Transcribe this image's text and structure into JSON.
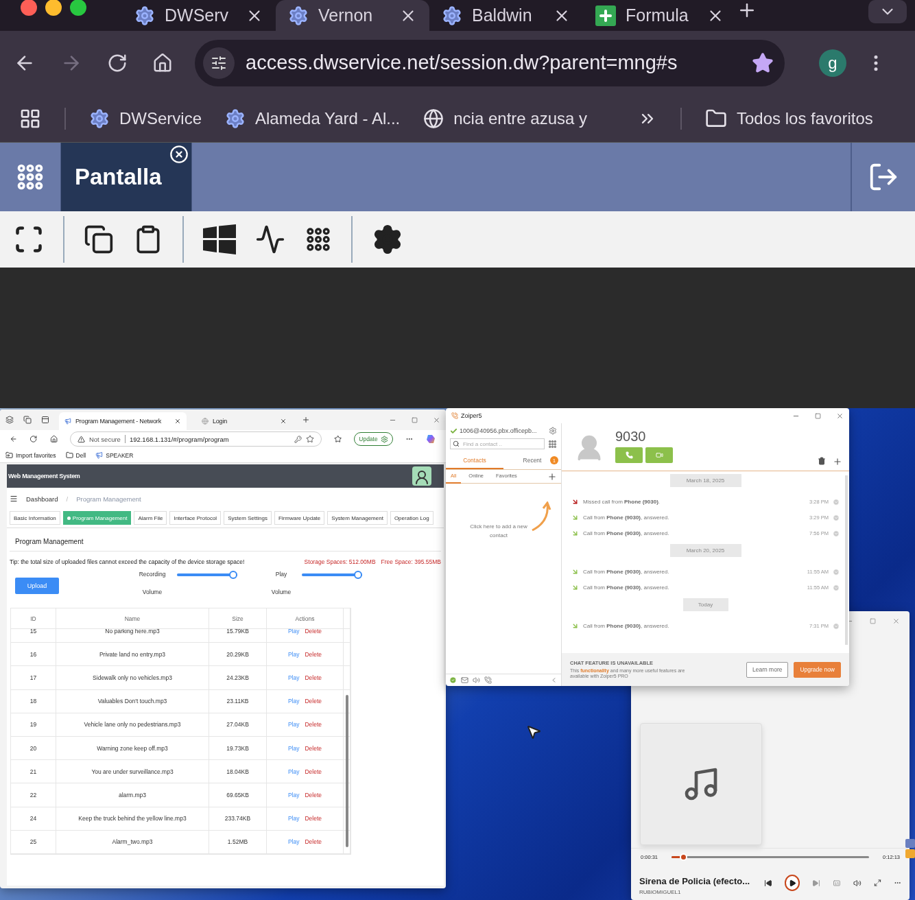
{
  "browser": {
    "tabs": [
      {
        "title": "DWServ",
        "kind": "gear",
        "selected": false
      },
      {
        "title": "Vernon",
        "kind": "gear",
        "selected": true
      },
      {
        "title": "Baldwin",
        "kind": "gear",
        "selected": false
      },
      {
        "title": "Formula",
        "kind": "sheet",
        "selected": false
      }
    ],
    "url": "access.dwservice.net/session.dw?parent=mng#s",
    "profile": "g",
    "bookmarks": [
      {
        "title": "DWService",
        "kind": "gear"
      },
      {
        "title": "Alameda Yard - Al...",
        "kind": "gear"
      },
      {
        "title": "ncia entre azusa y",
        "kind": "globe"
      }
    ],
    "all_bookmarks": "Todos los favoritos"
  },
  "session": {
    "tab": "Pantalla"
  },
  "edge": {
    "tabs": [
      {
        "title": "Program Management - Network",
        "selected": true
      },
      {
        "title": "Login",
        "selected": false
      }
    ],
    "security": "Not secure",
    "url": "192.168.1.131/#/program/program",
    "update": "Update",
    "favorites": [
      {
        "title": "Import favorites",
        "kind": "import"
      },
      {
        "title": "Dell",
        "kind": "folder"
      },
      {
        "title": "SPEAKER",
        "kind": "speaker"
      }
    ],
    "app_title": "Web Management System",
    "breadcrumb": [
      "Dashboard",
      "Program Management"
    ],
    "breadcrumb_separator": "/",
    "nav": [
      {
        "label": "Basic Information",
        "selected": false
      },
      {
        "label": "Program Management",
        "selected": true
      },
      {
        "label": "Alarm File",
        "selected": false
      },
      {
        "label": "Interface Protocol",
        "selected": false
      },
      {
        "label": "System Settings",
        "selected": false
      },
      {
        "label": "Firmware Update",
        "selected": false
      },
      {
        "label": "System Management",
        "selected": false
      },
      {
        "label": "Operation Log",
        "selected": false
      }
    ],
    "section_title": "Program Management",
    "tip": "Tip: the total size of uploaded files cannot exceed the capacity of the device storage space!",
    "storage": "Storage Spaces: 512.00MB",
    "free_space": "Free Space: 395.55MB",
    "upload": "Upload",
    "sliders": [
      {
        "label": "Recording",
        "sublabel": "Volume",
        "level": 1
      },
      {
        "label": "Play",
        "sublabel": "Volume",
        "level": 1
      }
    ],
    "table": {
      "columns": [
        "ID",
        "Name",
        "Size",
        "Actions"
      ],
      "rows": [
        {
          "id": "15",
          "name": "No parking here.mp3",
          "size": "15.79KB",
          "play": "Play",
          "delete": "Delete"
        },
        {
          "id": "16",
          "name": "Private land no entry.mp3",
          "size": "20.29KB",
          "play": "Play",
          "delete": "Delete"
        },
        {
          "id": "17",
          "name": "Sidewalk only no vehicles.mp3",
          "size": "24.23KB",
          "play": "Play",
          "delete": "Delete"
        },
        {
          "id": "18",
          "name": "Valuables Don't touch.mp3",
          "size": "23.11KB",
          "play": "Play",
          "delete": "Delete"
        },
        {
          "id": "19",
          "name": "Vehicle lane only no pedestrians.mp3",
          "size": "27.04KB",
          "play": "Play",
          "delete": "Delete"
        },
        {
          "id": "20",
          "name": "Warning zone keep off.mp3",
          "size": "19.73KB",
          "play": "Play",
          "delete": "Delete"
        },
        {
          "id": "21",
          "name": "You are under surveillance.mp3",
          "size": "18.04KB",
          "play": "Play",
          "delete": "Delete"
        },
        {
          "id": "22",
          "name": "alarm.mp3",
          "size": "69.65KB",
          "play": "Play",
          "delete": "Delete"
        },
        {
          "id": "24",
          "name": "Keep the truck behind the yellow line.mp3",
          "size": "233.74KB",
          "play": "Play",
          "delete": "Delete"
        },
        {
          "id": "25",
          "name": "Alarm_two.mp3",
          "size": "1.52MB",
          "play": "Play",
          "delete": "Delete"
        }
      ]
    }
  },
  "zoiper": {
    "title": "Zoiper5",
    "account": "1006@40956.pbx.officepb...",
    "search_placeholder": "Find a contact ..",
    "tabs": [
      {
        "label": "Contacts",
        "selected": true
      },
      {
        "label": "Recent",
        "selected": false,
        "badge": "1"
      }
    ],
    "subtabs": [
      {
        "label": "All",
        "selected": true
      },
      {
        "label": "Online",
        "selected": false
      },
      {
        "label": "Favorites",
        "selected": false
      }
    ],
    "hint": "Click here to add a new contact",
    "contact": "9030",
    "history": [
      {
        "date": "March 18, 2025",
        "calls": [
          {
            "kind": "missed",
            "text": "Missed call from **Phone (9030)**.",
            "time": "3:28 PM"
          },
          {
            "kind": "answered",
            "text": "Call from **Phone (9030)**, answered.",
            "time": "3:29 PM"
          },
          {
            "kind": "answered",
            "text": "Call from **Phone (9030)**, answered.",
            "time": "7:56 PM"
          }
        ]
      },
      {
        "date": "March 20, 2025",
        "calls": [
          {
            "kind": "answered",
            "text": "Call from **Phone (9030)**, answered.",
            "time": "11:55 AM"
          },
          {
            "kind": "answered",
            "text": "Call from **Phone (9030)**, answered.",
            "time": "11:55 AM"
          }
        ]
      },
      {
        "date": "Today",
        "calls": [
          {
            "kind": "answered",
            "text": "Call from **Phone (9030)**, answered.",
            "time": "7:31 PM"
          }
        ]
      }
    ],
    "chat_title": "CHAT FEATURE IS UNAVAILABLE",
    "chat_text": "This **functionality** and many more useful features are available with Zoiper5 PRO",
    "learn_more": "Learn more",
    "upgrade": "Upgrade now"
  },
  "player": {
    "elapsed": "0:00:31",
    "total": "0:12:13",
    "level": 0.06,
    "title": "Sirena de Policia (efecto...",
    "artist": "RUBIOMIGUEL1"
  }
}
